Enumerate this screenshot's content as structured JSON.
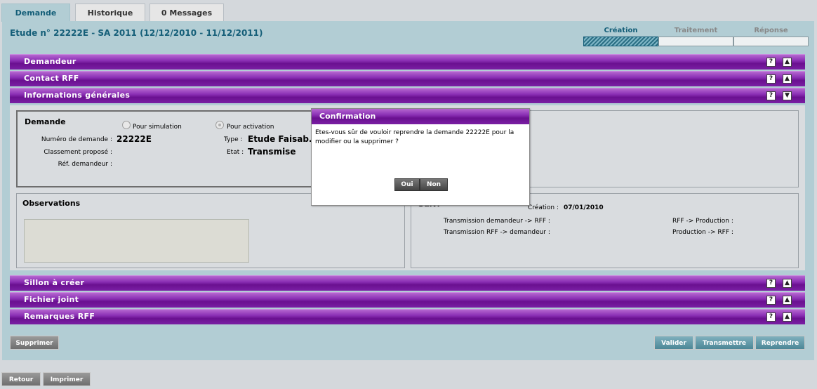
{
  "tabs": [
    {
      "label": "Demande"
    },
    {
      "label": "Historique"
    },
    {
      "label": "0 Messages"
    }
  ],
  "study_title": "Etude n° 22222E - SA 2011 (12/12/2010 - 11/12/2011)",
  "steps": [
    {
      "label": "Création",
      "state": "current"
    },
    {
      "label": "Traitement",
      "state": "pending"
    },
    {
      "label": "Réponse",
      "state": "pending"
    }
  ],
  "sections": {
    "demandeur": "Demandeur",
    "contact_rff": "Contact RFF",
    "informations_generales": "Informations générales",
    "sillon": "Sillon à créer",
    "fichier_joint": "Fichier joint",
    "remarques_rff": "Remarques RFF",
    "help_glyph": "?"
  },
  "demande": {
    "title": "Demande",
    "radio_simulation": "Pour simulation",
    "radio_activation": "Pour activation",
    "numero_label": "Numéro de demande :",
    "numero_value": "22222E",
    "classement_label": "Classement proposé :",
    "ref_label": "Réf. demandeur :",
    "type_label": "Type :",
    "type_value": "Etude Faisab.",
    "etat_label": "Etat :",
    "etat_value": "Transmise"
  },
  "observations": {
    "title": "Observations"
  },
  "suivi": {
    "title_partial": "Suivi",
    "creation_label": "Création :",
    "creation_value": "07/01/2010",
    "trans_dem_rff": "Transmission demandeur -> RFF :",
    "trans_rff_dem": "Transmission RFF -> demandeur :",
    "rff_production": "RFF -> Production :",
    "production_rff": "Production -> RFF :"
  },
  "buttons": {
    "supprimer": "Supprimer",
    "valider": "Valider",
    "transmettre": "Transmettre",
    "reprendre": "Reprendre",
    "retour": "Retour",
    "imprimer": "Imprimer"
  },
  "modal": {
    "title": "Confirmation",
    "message": "Etes-vous sûr de vouloir reprendre la demande 22222E pour la modifier ou la supprimer ?",
    "oui": "Oui",
    "non": "Non"
  },
  "colors": {
    "accent_teal": "#145e78",
    "panel_bg": "#b2cdd4",
    "section_purple": "#7a1fa4"
  }
}
